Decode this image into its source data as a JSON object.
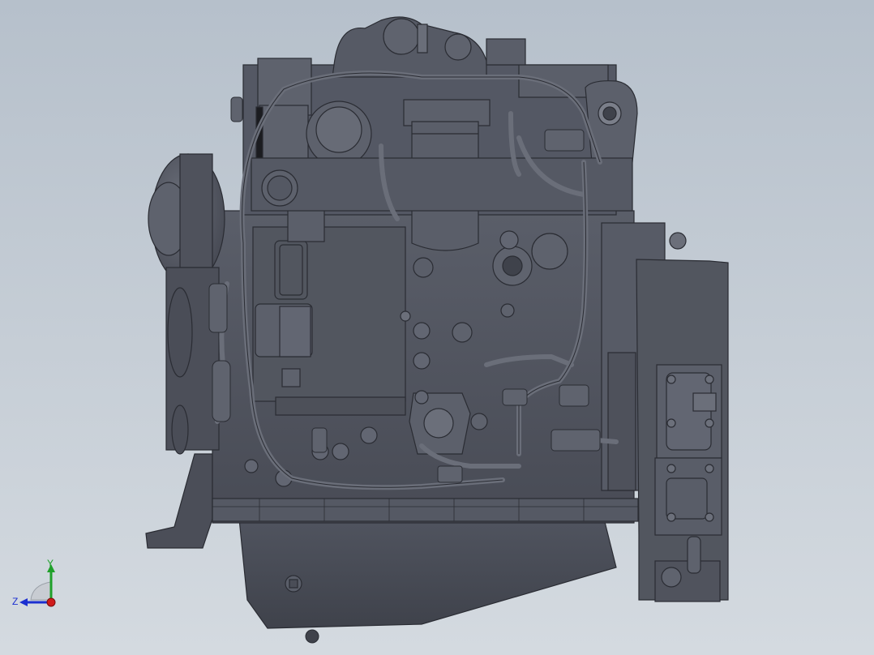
{
  "scene": {
    "subject": "diesel-engine-side-view",
    "background_top": "#b6c0cb",
    "background_bottom": "#d4dae0",
    "body_color": "#4e515c",
    "body_dark": "#3a3c45",
    "body_light": "#666a75",
    "edge_color": "#2a2c33"
  },
  "triad": {
    "y_label": "Y",
    "z_label": "Z",
    "y_color": "#1fa02a",
    "z_color": "#1b2fd0",
    "x_color": "#d01b1b"
  }
}
